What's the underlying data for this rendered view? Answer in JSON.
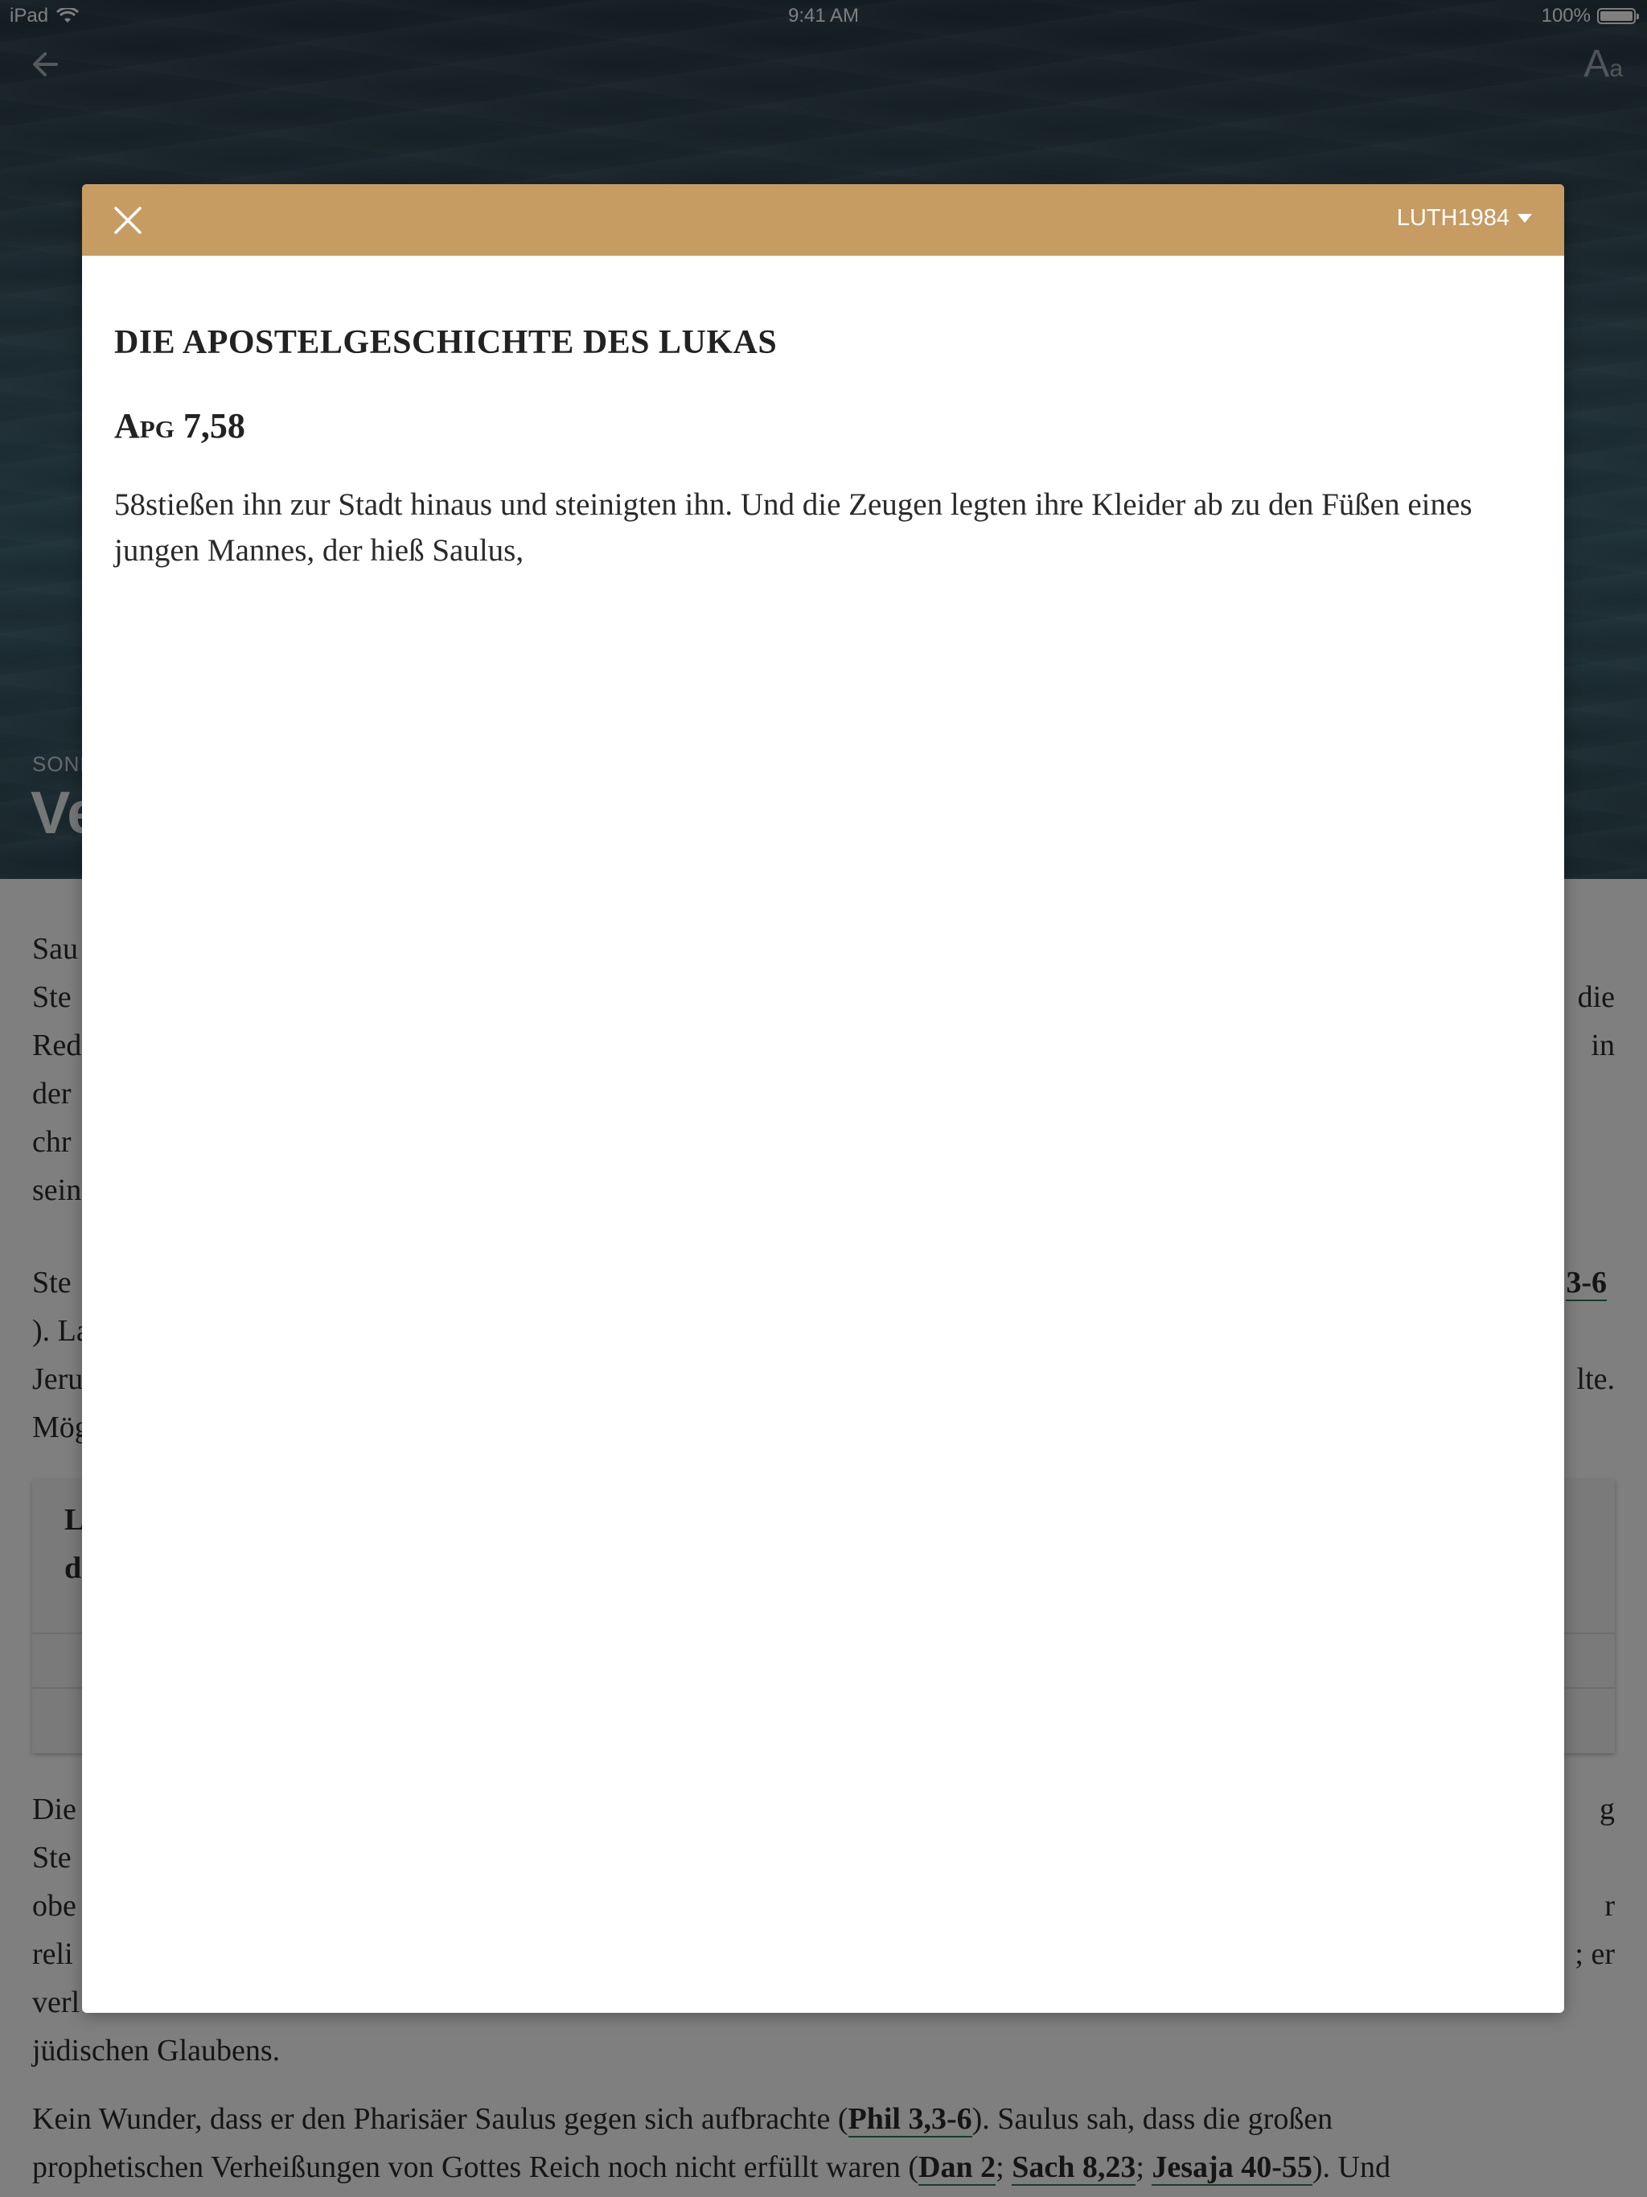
{
  "status_bar": {
    "device": "iPad",
    "time": "9:41 AM",
    "battery": "100%"
  },
  "nav": {
    "font_big": "A",
    "font_small": "a"
  },
  "hero": {
    "day_label": "SONN",
    "title": "Ve"
  },
  "article": {
    "p1_lines": [
      "Sau",
      "Ste",
      "Red",
      "der",
      "chr",
      "sein"
    ],
    "p1_right": [
      "die",
      "in"
    ],
    "p2_lines": [
      "Ste",
      "). La",
      "Jeru",
      "Mög"
    ],
    "p2_right_ref": "3-6",
    "p2_right": "lte.",
    "callout_lines": [
      "L",
      "d"
    ],
    "p3_lines": [
      "Die",
      "Ste",
      "obe",
      "reli",
      "verl",
      "jüdischen Glaubens."
    ],
    "p3_right": [
      "g",
      "r",
      "; er"
    ],
    "p4_text_1": "Kein Wunder, dass er den Pharisäer Saulus gegen sich aufbrachte (",
    "p4_ref_1": "Phil 3,3-6",
    "p4_text_2": "). Saulus sah, dass die großen",
    "p4_text_3": "prophetischen Verheißungen von Gottes Reich noch nicht erfüllt waren (",
    "p4_ref_2": "Dan 2",
    "p4_sep_1": "; ",
    "p4_ref_3": "Sach 8,23",
    "p4_sep_2": "; ",
    "p4_ref_4": "Jesaja 40-55",
    "p4_text_4": "). Und"
  },
  "modal": {
    "version": "LUTH1984",
    "book_title": "DIE APOSTELGESCHICHTE DES LUKAS",
    "verse_ref": "Apg 7,58",
    "verse_text": "58stießen ihn zur Stadt hinaus und steinigten ihn. Und die Zeugen legten ihre Kleider ab zu den Füßen eines jungen Mannes, der hieß Saulus,"
  },
  "colors": {
    "header_gold": "#c69c63",
    "link_green": "#2d7a55"
  }
}
